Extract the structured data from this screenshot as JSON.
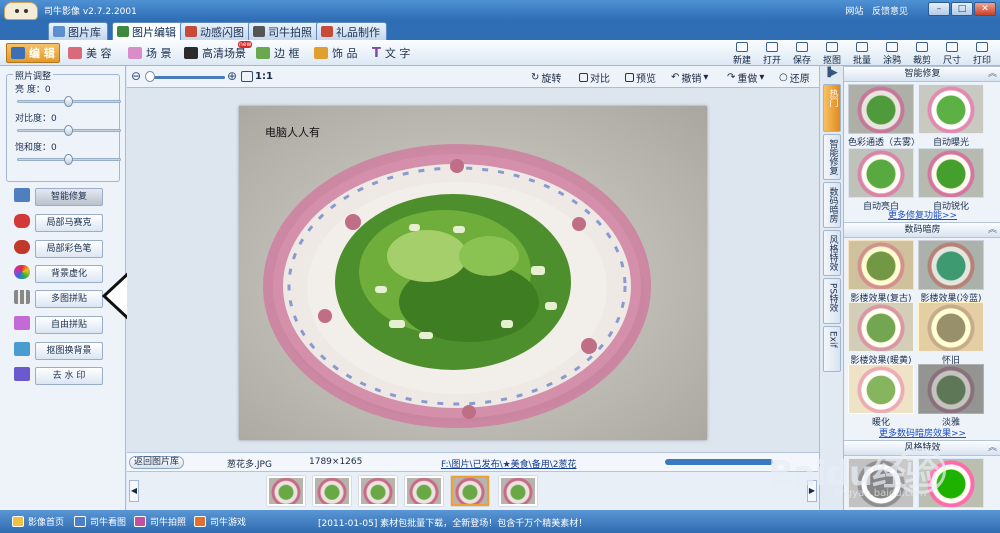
{
  "app": {
    "title": "司牛影像  v2.7.2.2001",
    "links": [
      "网站",
      "反馈意见"
    ],
    "window_buttons": [
      "–",
      "□",
      "✕"
    ]
  },
  "tabs": [
    {
      "label": "图片库",
      "color": "#5b8fd0"
    },
    {
      "label": "图片编辑",
      "color": "#3d8a3d"
    },
    {
      "label": "动感闪图",
      "color": "#c84b3a"
    },
    {
      "label": "司牛拍照",
      "color": "#555"
    },
    {
      "label": "礼品制作",
      "color": "#c84b3a"
    }
  ],
  "toolbar": {
    "tools": [
      {
        "label": "编 辑",
        "color": "#3d6fb5"
      },
      {
        "label": "美 容",
        "color": "#d86a7a"
      },
      {
        "label": "场 景",
        "color": "#d88fc8"
      },
      {
        "label": "高清场景",
        "color": "#2b2b2b",
        "badge": "new"
      },
      {
        "label": "边 框",
        "color": "#6aa84f"
      },
      {
        "label": "饰 品",
        "color": "#e0a030"
      },
      {
        "label": "文 字",
        "color": "#7a4aa8",
        "glyph": "T"
      }
    ],
    "right_tools": [
      "新建",
      "打开",
      "保存",
      "抠图",
      "批量",
      "涂鸦",
      "裁剪",
      "尺寸",
      "打印"
    ]
  },
  "adjust": {
    "legend": "照片调整",
    "items": [
      {
        "label": "亮  度：0",
        "value": 0
      },
      {
        "label": "对比度：0",
        "value": 0
      },
      {
        "label": "饱和度：0",
        "value": 0
      }
    ]
  },
  "functions": [
    {
      "label": "智能修复",
      "color": "#4f7fbf"
    },
    {
      "label": "局部马赛克",
      "color": "#d23a3a"
    },
    {
      "label": "局部彩色笔",
      "color": "#c0392b"
    },
    {
      "label": "背景虚化",
      "color": "#e0a020"
    },
    {
      "label": "多图拼贴",
      "color": "#888"
    },
    {
      "label": "自由拼贴",
      "color": "#c36ad6"
    },
    {
      "label": "抠图换背景",
      "color": "#4a9bd0"
    },
    {
      "label": "去 水 印",
      "color": "#6a5acd"
    }
  ],
  "view": {
    "zoom_label": "1:1",
    "zoom_level": 0.1,
    "tools": [
      {
        "label": "旋转",
        "icon": "rotate-icon"
      },
      {
        "label": "对比",
        "icon": "compare-icon"
      },
      {
        "label": "预览",
        "icon": "preview-icon"
      },
      {
        "label": "撤销",
        "icon": "undo-icon"
      },
      {
        "label": "重做",
        "icon": "redo-icon"
      },
      {
        "label": "还原",
        "icon": "restore-icon"
      }
    ]
  },
  "photo": {
    "caption": "电脑人人有"
  },
  "status": {
    "back": "返回图片库",
    "filename": "葱花多.JPG",
    "dimensions": "1789×1265",
    "path": "F:\\图片\\已发布\\★美食\\备用\\2葱花"
  },
  "thumbs": {
    "count": 6,
    "selected": 4
  },
  "right": {
    "vtab_top": "▐▶",
    "vtabs": [
      {
        "label": "热门",
        "active": true
      },
      {
        "label": "智能修复"
      },
      {
        "label": "数码暗房"
      },
      {
        "label": "风格特效"
      },
      {
        "label": "PS特效"
      },
      {
        "label": "Exif"
      }
    ],
    "sections": [
      {
        "title": "智能修复",
        "effects": [
          "色彩通透（去雾）",
          "自动曝光",
          "自动亮白",
          "自动锐化"
        ],
        "more": "更多修复功能>>"
      },
      {
        "title": "数码暗房",
        "effects": [
          "影楼效果(复古)",
          "影楼效果(冷蓝)",
          "影楼效果(暖黄)",
          "怀旧",
          "暖化",
          "淡雅"
        ],
        "more": "更多数码暗房效果>>"
      },
      {
        "title": "风格特效",
        "effects": [
          "",
          ""
        ],
        "more": ""
      }
    ]
  },
  "bottom": {
    "items": [
      "影像首页",
      "司牛看图",
      "司牛拍照",
      "司牛游戏"
    ],
    "news": "[2011-01-05] 素材包批量下载，全新登场！包含千万个精美素材！"
  },
  "watermark": {
    "text": "Baidu经验",
    "url": "jingyan.baidu.com"
  }
}
